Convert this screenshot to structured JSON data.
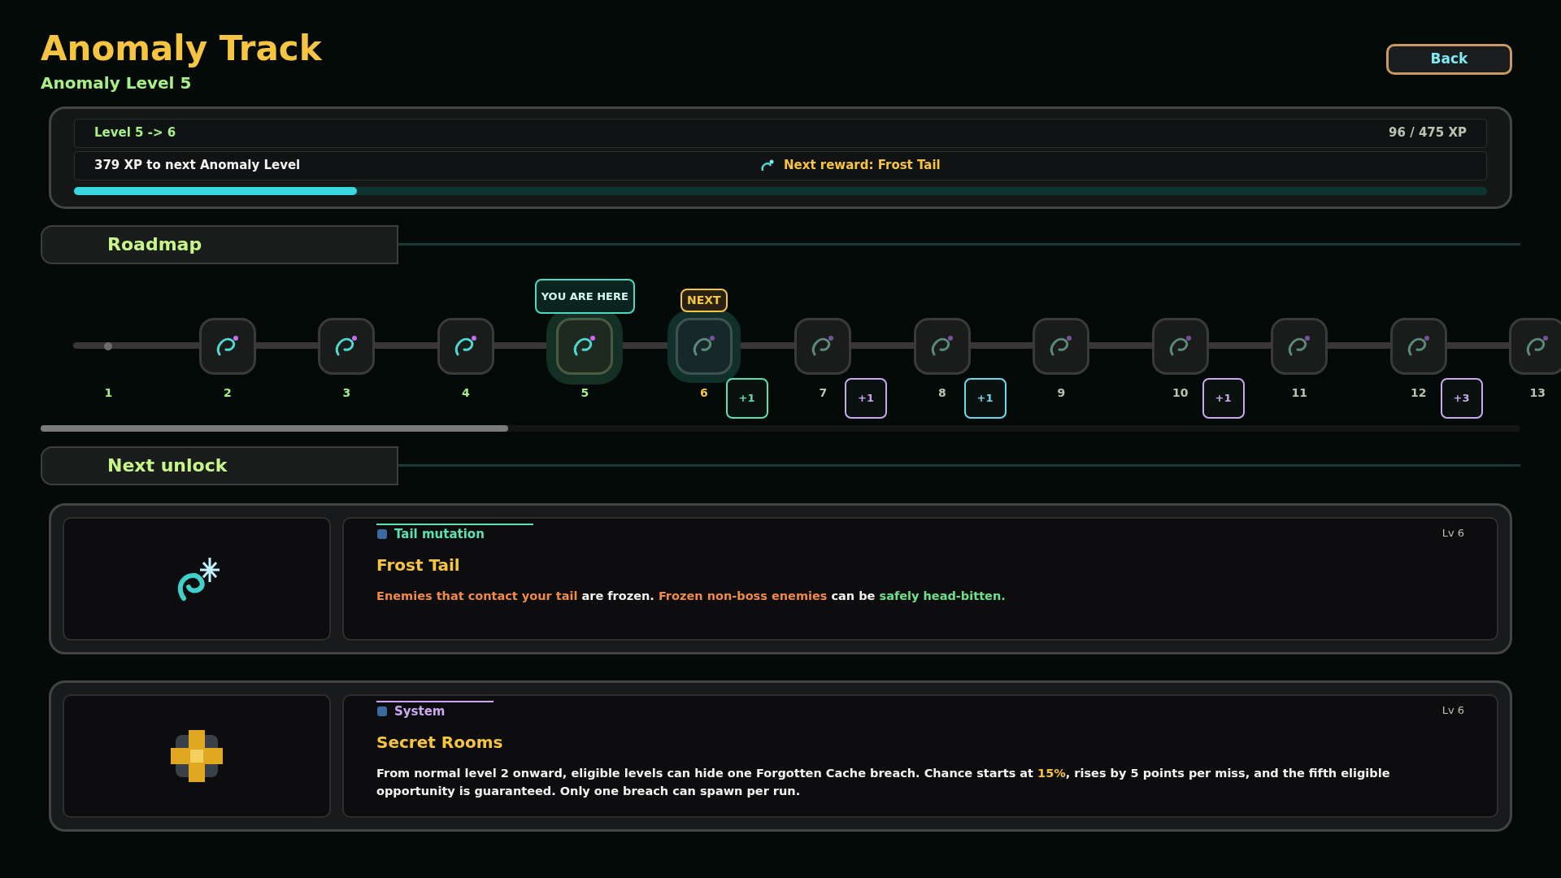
{
  "header": {
    "title": "Anomaly Track",
    "subtitle": "Anomaly Level 5",
    "back_button": "Back"
  },
  "xp_panel": {
    "level_range": "Level 5 -> 6",
    "xp_reading": "96 / 475 XP",
    "xp_remaining": "379 XP to next Anomaly Level",
    "next_reward": "Next reward: Frost Tail",
    "level": 0.2
  },
  "roadmap": {
    "heading": "Roadmap",
    "nodes": [
      {
        "number": "1",
        "reached": true,
        "current": false,
        "next": false,
        "kind": "start"
      },
      {
        "number": "2",
        "reached": true,
        "current": false,
        "next": false,
        "kind": "reward"
      },
      {
        "number": "3",
        "reached": true,
        "current": false,
        "next": false,
        "kind": "reward"
      },
      {
        "number": "4",
        "reached": true,
        "current": false,
        "next": false,
        "kind": "reward"
      },
      {
        "number": "5",
        "reached": true,
        "current": true,
        "next": false,
        "kind": "reward",
        "tag": "YOU ARE HERE"
      },
      {
        "number": "6",
        "reached": false,
        "current": false,
        "next": true,
        "kind": "reward",
        "tag": "NEXT",
        "badge": {
          "text": "+1",
          "color": "#5ee0b0"
        }
      },
      {
        "number": "7",
        "reached": false,
        "current": false,
        "next": false,
        "kind": "reward",
        "badge": {
          "text": "+1",
          "color": "#c9a8f0"
        }
      },
      {
        "number": "8",
        "reached": false,
        "current": false,
        "next": false,
        "kind": "reward",
        "badge": {
          "text": "+1",
          "color": "#6fd8f0"
        }
      },
      {
        "number": "9",
        "reached": false,
        "current": false,
        "next": false,
        "kind": "reward"
      },
      {
        "number": "10",
        "reached": false,
        "current": false,
        "next": false,
        "kind": "reward",
        "badge": {
          "text": "+1",
          "color": "#c9a8f0"
        }
      },
      {
        "number": "11",
        "reached": false,
        "current": false,
        "next": false,
        "kind": "reward"
      },
      {
        "number": "12",
        "reached": false,
        "current": false,
        "next": false,
        "kind": "reward",
        "badge": {
          "text": "+3",
          "color": "#c9a8f0"
        }
      },
      {
        "number": "13",
        "reached": false,
        "current": false,
        "next": false,
        "kind": "reward"
      }
    ]
  },
  "next_unlock": {
    "heading": "Next unlock",
    "cards": [
      {
        "category": {
          "text": "Tail mutation",
          "color": "#5ee0b0"
        },
        "level": "Lv 6",
        "title": "Frost Tail",
        "description": [
          {
            "text": "Enemies that contact your tail",
            "color": "#f08a4b"
          },
          {
            "text": " are frozen. ",
            "color": "#f2f2f2"
          },
          {
            "text": "Frozen non-boss enemies",
            "color": "#f08a4b"
          },
          {
            "text": " can be ",
            "color": "#f2f2f2"
          },
          {
            "text": "safely head-bitten.",
            "color": "#6ee08a"
          }
        ]
      },
      {
        "category": {
          "text": "System",
          "color": "#c9a8f0"
        },
        "level": "Lv 6",
        "title": "Secret Rooms",
        "description": [
          {
            "text": "From normal level 2 onward, eligible levels can hide one Forgotten Cache breach. Chance starts at ",
            "color": "#f2f2f2"
          },
          {
            "text": "15%",
            "color": "#f5c542"
          },
          {
            "text": ", rises by 5 points per miss, and the fifth eligible opportunity is guaranteed. Only one breach can spawn per run.",
            "color": "#f2f2f2"
          }
        ]
      }
    ]
  }
}
